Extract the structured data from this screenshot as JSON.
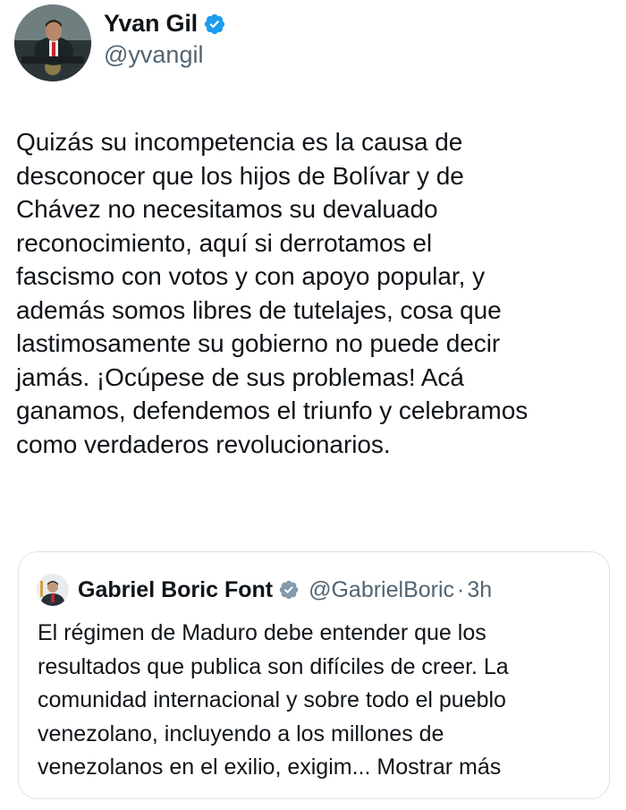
{
  "author": {
    "display_name": "Yvan Gil",
    "handle": "@yvangil",
    "verified_icon": "verified-badge-icon",
    "avatar": "profile-photo"
  },
  "tweet": {
    "text": "Quizás su incompetencia es la causa de\ndesconocer que los hijos de Bolívar y de\nChávez no necesitamos su devaluado\nreconocimiento, aquí si derrotamos el\nfascismo con votos y con apoyo popular, y\nademás somos libres de tutelajes, cosa que\nlastimosamente su gobierno no puede decir\njamás. ¡Ocúpese de sus problemas! Acá\nganamos, defendemos el triunfo y celebramos\ncomo verdaderos revolucionarios."
  },
  "quoted_tweet": {
    "display_name": "Gabriel Boric Font",
    "handle": "@GabrielBoric",
    "separator": "·",
    "time": "3h",
    "text": "El régimen de Maduro debe entender que los\nresultados que publica son difíciles de creer. La\ncomunidad internacional y sobre todo el pueblo\nvenezolano, incluyendo a los millones de\nvenezolanos en el exilio, exigim... ",
    "show_more_label": "Mostrar más"
  },
  "colors": {
    "text_primary": "#0f1419",
    "text_secondary": "#536471",
    "verified_blue": "#1d9bf0",
    "verified_gray": "#829aab",
    "border": "#dfe3e6"
  }
}
